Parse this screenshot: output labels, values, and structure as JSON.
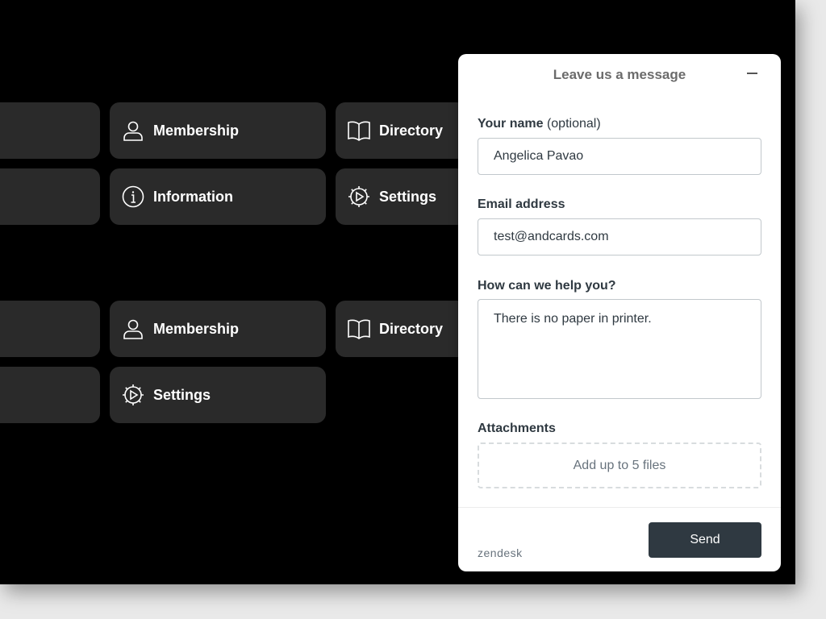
{
  "tiles": {
    "membership_1": "Membership",
    "directory_1": "Directory",
    "information": "Information",
    "settings_1": "Settings",
    "membership_2": "Membership",
    "directory_2": "Directory",
    "settings_2": "Settings"
  },
  "widget": {
    "title": "Leave us a message",
    "name_label": "Your name",
    "name_optional": "(optional)",
    "name_value": "Angelica Pavao",
    "email_label": "Email address",
    "email_value": "test@andcards.com",
    "help_label": "How can we help you?",
    "help_value": "There is no paper in printer.",
    "attachments_label": "Attachments",
    "attachments_hint": "Add up to 5 files",
    "brand": "zendesk",
    "send_label": "Send"
  }
}
